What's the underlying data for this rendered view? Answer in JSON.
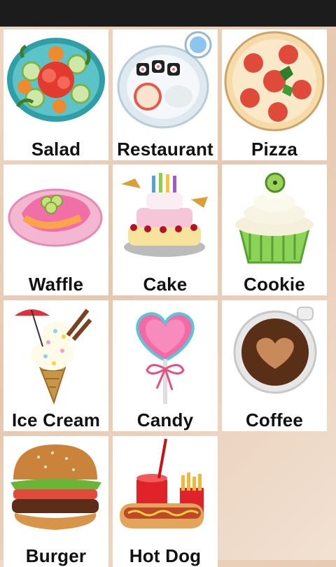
{
  "menu": {
    "items": [
      {
        "label": "Salad",
        "icon": "salad-icon"
      },
      {
        "label": "Restaurant",
        "icon": "sushi-plate-icon"
      },
      {
        "label": "Pizza",
        "icon": "pizza-icon"
      },
      {
        "label": "Waffle",
        "icon": "waffle-icon"
      },
      {
        "label": "Cake",
        "icon": "cake-icon"
      },
      {
        "label": "Cookie",
        "icon": "cupcake-icon"
      },
      {
        "label": "Ice Cream",
        "icon": "ice-cream-cone-icon"
      },
      {
        "label": "Candy",
        "icon": "heart-lollipop-icon"
      },
      {
        "label": "Coffee",
        "icon": "coffee-cup-icon"
      },
      {
        "label": "Burger",
        "icon": "burger-icon"
      },
      {
        "label": "Hot Dog",
        "icon": "hot-dog-icon"
      }
    ]
  },
  "colors": {
    "status_bar": "#1c1c1c",
    "background": "#ead2be",
    "tile": "#ffffff",
    "label": "#111111"
  }
}
